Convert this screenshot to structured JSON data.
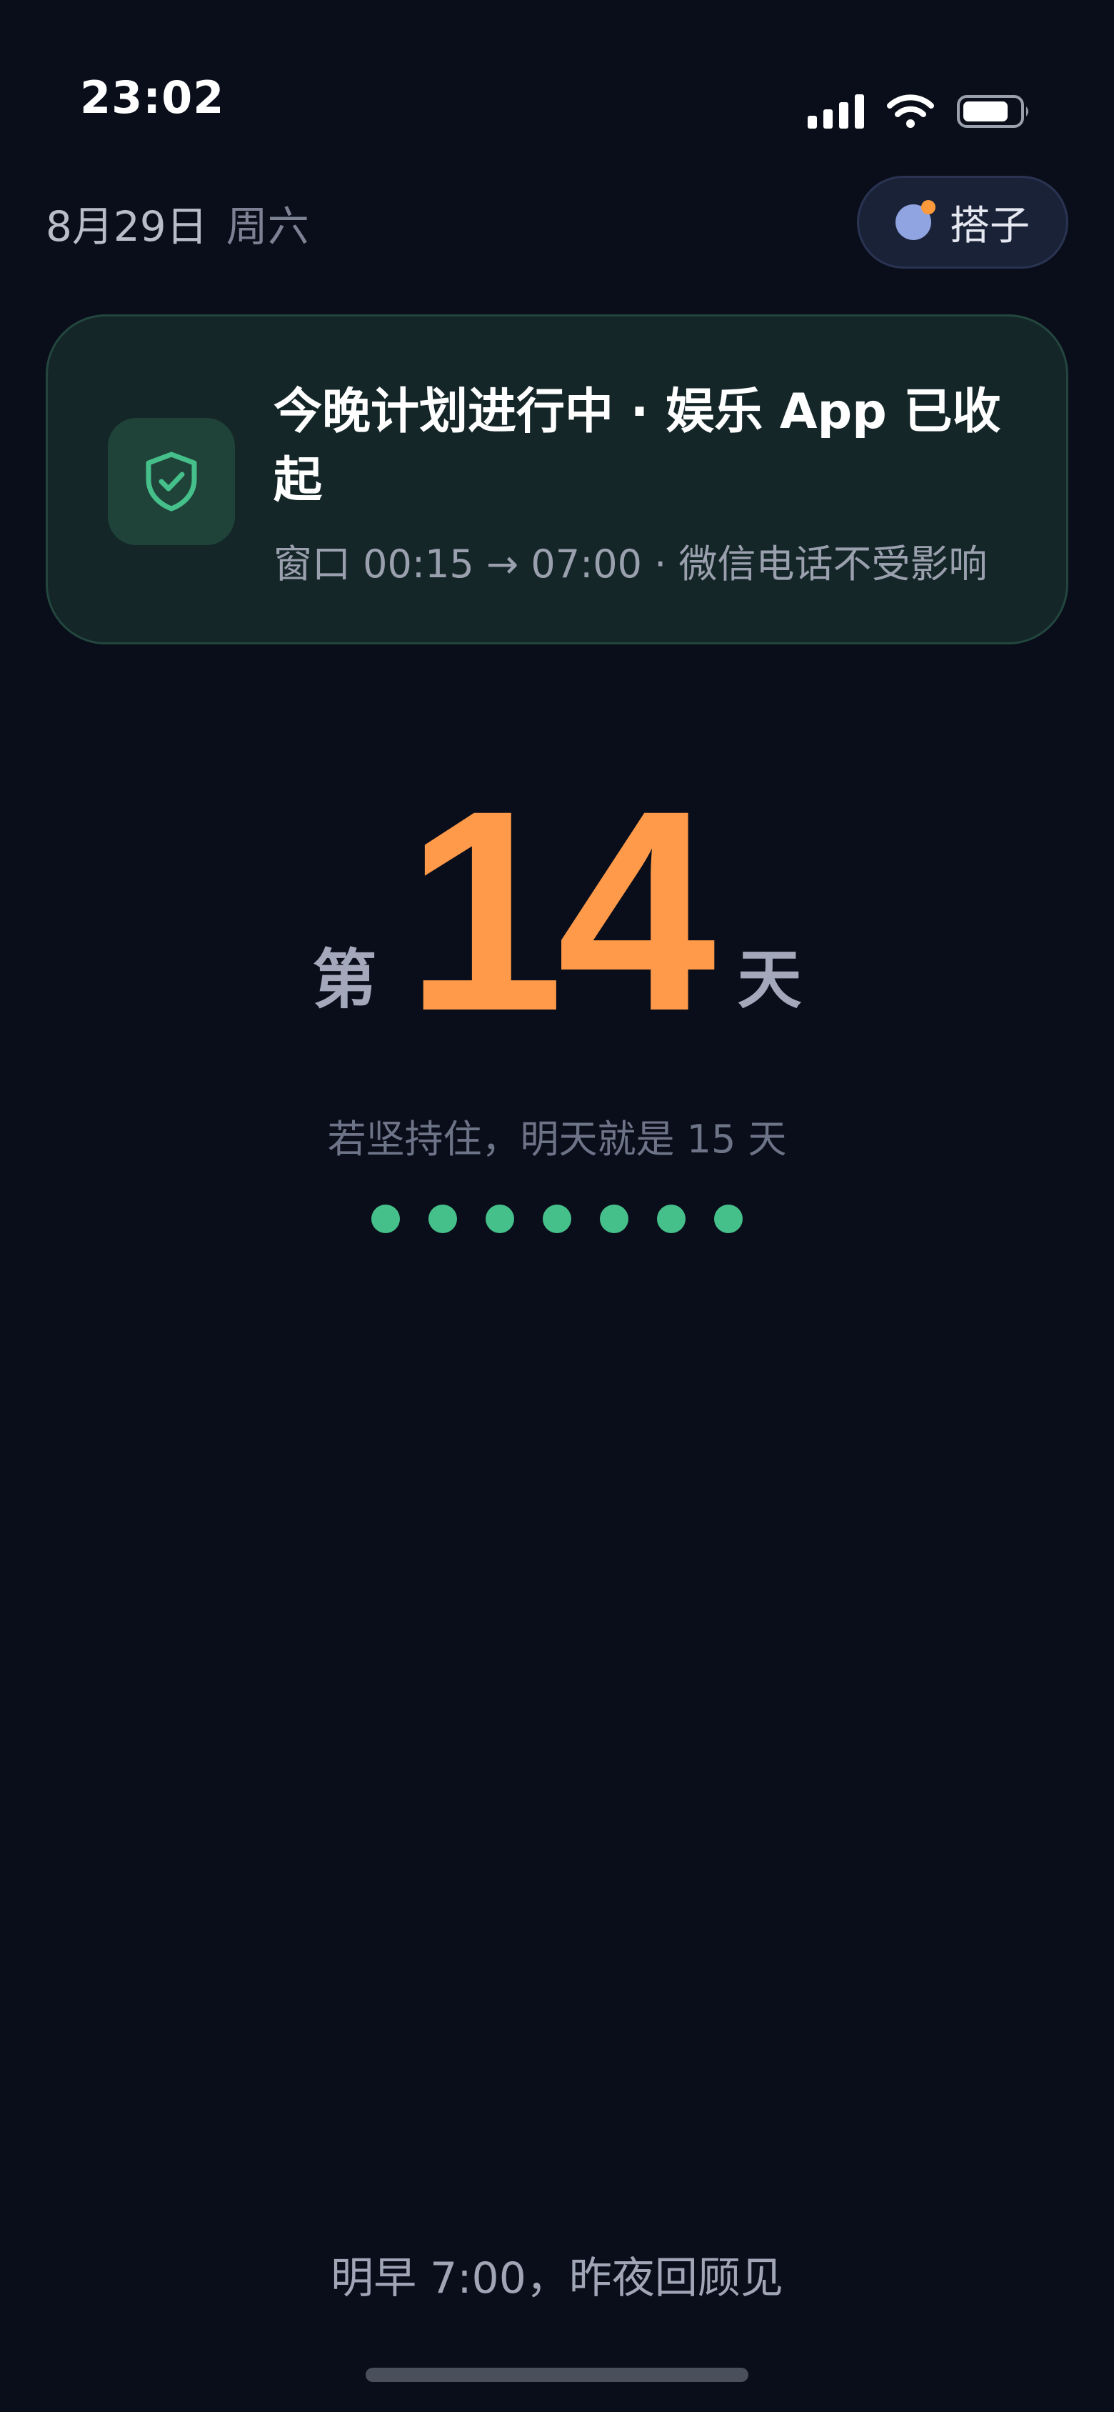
{
  "status_bar": {
    "time": "23:02"
  },
  "header": {
    "date": "8月29日",
    "weekday": "周六",
    "buddy_label": "搭子"
  },
  "plan_card": {
    "title": "今晚计划进行中 · 娱乐 App 已收起",
    "subtitle": "窗口 00:15 → 07:00 · 微信电话不受影响",
    "icon": "shield-check-icon"
  },
  "streak": {
    "prefix": "第",
    "number": "14",
    "suffix": "天",
    "hint": "若坚持住，明天就是 15 天",
    "dots_count": 7
  },
  "footer": {
    "text": "明早 7:00，昨夜回顾见"
  },
  "colors": {
    "background": "#0a0e1a",
    "accent": "#ff9a4a",
    "success": "#46c08b",
    "card": "#152628"
  }
}
